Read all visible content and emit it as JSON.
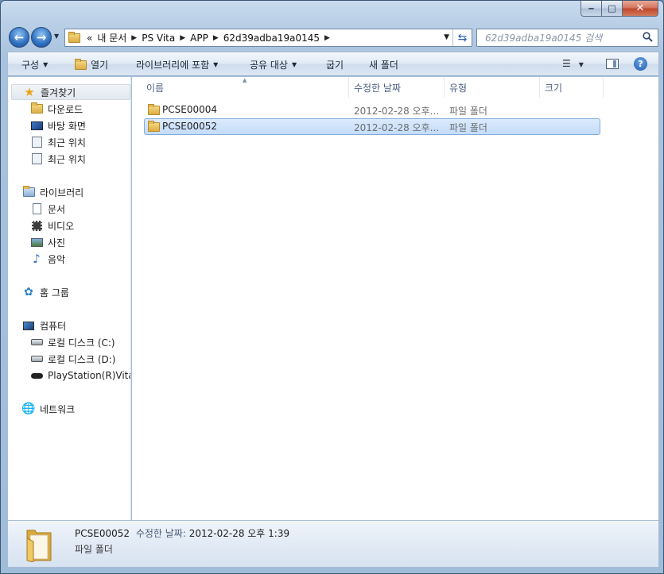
{
  "window": {
    "caption_buttons": {
      "minimize": "‒",
      "maximize": "□",
      "close": "✕"
    }
  },
  "address_bar": {
    "overflow": "«",
    "crumbs": [
      "내 문서",
      "PS Vita",
      "APP",
      "62d39adba19a0145"
    ],
    "search_placeholder": "62d39adba19a0145 검색"
  },
  "toolbar": {
    "organize": "구성",
    "open": "열기",
    "include_in_library": "라이브러리에 포함",
    "share_with": "공유 대상",
    "burn": "굽기",
    "new_folder": "새 폴더",
    "help": "?"
  },
  "sidebar": {
    "favorites": {
      "label": "즐겨찾기",
      "icon": "star-icon",
      "items": [
        {
          "label": "다운로드",
          "icon": "downloads-icon"
        },
        {
          "label": "바탕 화면",
          "icon": "desktop-icon"
        },
        {
          "label": "최근 위치",
          "icon": "recent-places-icon"
        },
        {
          "label": "최근 위치",
          "icon": "recent-places-icon"
        }
      ]
    },
    "libraries": {
      "label": "라이브러리",
      "icon": "library-icon",
      "items": [
        {
          "label": "문서",
          "icon": "documents-icon"
        },
        {
          "label": "비디오",
          "icon": "video-icon"
        },
        {
          "label": "사진",
          "icon": "pictures-icon"
        },
        {
          "label": "음악",
          "icon": "music-icon"
        }
      ]
    },
    "homegroup": {
      "label": "홈 그룹",
      "icon": "homegroup-icon"
    },
    "computer": {
      "label": "컴퓨터",
      "icon": "computer-icon",
      "items": [
        {
          "label": "로컬 디스크 (C:)",
          "icon": "drive-c-icon"
        },
        {
          "label": "로컬 디스크 (D:)",
          "icon": "drive-d-icon"
        },
        {
          "label": "PlayStation(R)Vita",
          "icon": "vita-device-icon"
        }
      ]
    },
    "network": {
      "label": "네트워크",
      "icon": "network-icon"
    }
  },
  "file_list": {
    "columns": [
      "이름",
      "수정한 날짜",
      "유형",
      "크기"
    ],
    "rows": [
      {
        "name": "PCSE00004",
        "modified": "2012-02-28 오후...",
        "type": "파일 폴더",
        "size": "",
        "selected": false
      },
      {
        "name": "PCSE00052",
        "modified": "2012-02-28 오후...",
        "type": "파일 폴더",
        "size": "",
        "selected": true
      }
    ]
  },
  "details_pane": {
    "name": "PCSE00052",
    "modified_label": "수정한 날짜:",
    "modified_value": "2012-02-28 오후 1:39",
    "type": "파일 폴더"
  },
  "colors": {
    "selection_fill": "#c4dcfa",
    "selection_border": "#84acdd",
    "header_text": "#4d6185",
    "folder_yellow": "#dcae47"
  }
}
